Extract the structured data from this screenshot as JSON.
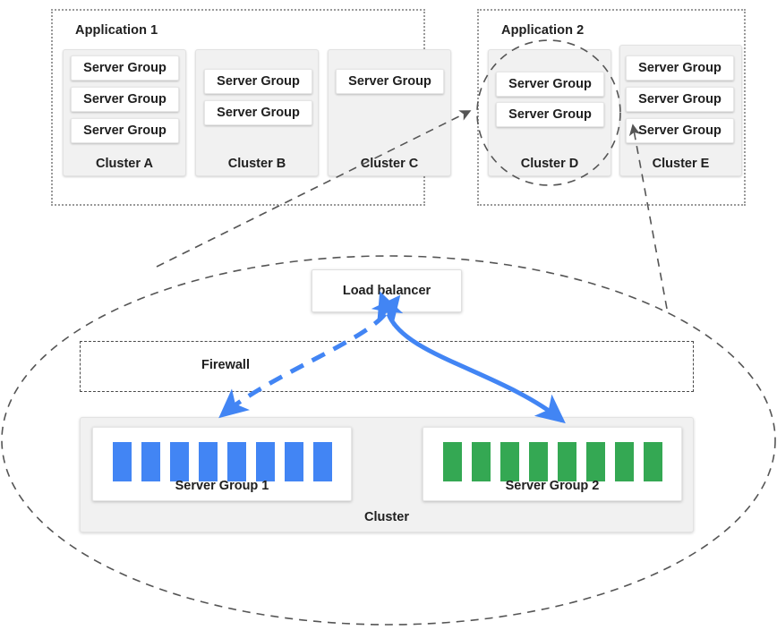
{
  "applications": [
    {
      "id": "application-1",
      "title": "Application 1",
      "clusters": [
        {
          "id": "cluster-a",
          "label": "Cluster A",
          "server_groups": [
            "Server Group",
            "Server Group",
            "Server Group"
          ]
        },
        {
          "id": "cluster-b",
          "label": "Cluster B",
          "server_groups": [
            "Server Group",
            "Server Group"
          ]
        },
        {
          "id": "cluster-c",
          "label": "Cluster C",
          "server_groups": [
            "Server Group"
          ]
        }
      ]
    },
    {
      "id": "application-2",
      "title": "Application 2",
      "clusters": [
        {
          "id": "cluster-d",
          "label": "Cluster D",
          "server_groups": [
            "Server Group",
            "Server Group"
          ],
          "highlighted": true
        },
        {
          "id": "cluster-e",
          "label": "Cluster E",
          "server_groups": [
            "Server Group",
            "Server Group",
            "Server Group"
          ]
        }
      ]
    }
  ],
  "detail": {
    "load_balancer_label": "Load balancer",
    "firewall_label": "Firewall",
    "cluster_label": "Cluster",
    "server_groups": [
      {
        "id": "server-group-1",
        "label": "Server Group 1",
        "node_count": 8,
        "color": "#4285f4"
      },
      {
        "id": "server-group-2",
        "label": "Server Group 2",
        "node_count": 8,
        "color": "#34a853"
      }
    ]
  },
  "colors": {
    "blue": "#4285f4",
    "green": "#34a853",
    "dashed_gray": "#555555",
    "dotted_gray": "#9a9a9a",
    "panel_gray": "#f1f1f1",
    "background": "#ffffff"
  }
}
